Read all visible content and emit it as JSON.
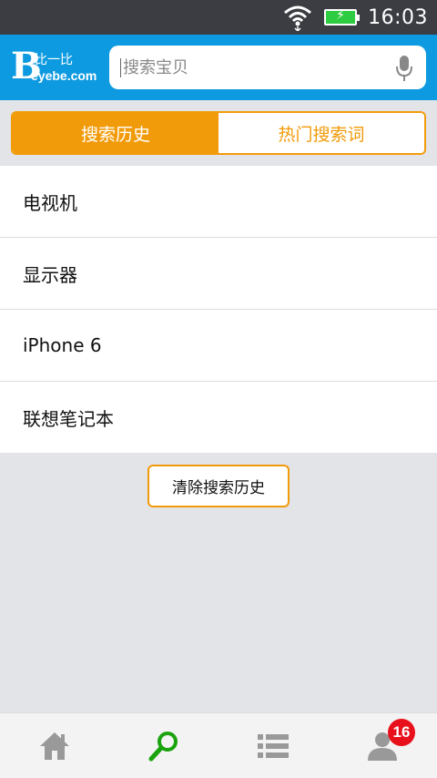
{
  "status_bar": {
    "time": "16:03",
    "icons": [
      "wifi-icon",
      "battery-charging-icon"
    ]
  },
  "header": {
    "logo": {
      "letter": "B",
      "cn_text": "比一比",
      "en_text": "eyebe.com"
    },
    "search": {
      "placeholder": "搜索宝贝",
      "value": ""
    },
    "mic_icon": "microphone-icon"
  },
  "tabs": [
    {
      "label": "搜索历史",
      "active": true
    },
    {
      "label": "热门搜索词",
      "active": false
    }
  ],
  "history": {
    "items": [
      "电视机",
      "显示器",
      "iPhone 6",
      "联想笔记本"
    ],
    "clear_label": "清除搜索历史"
  },
  "bottom_nav": {
    "items": [
      "home-icon",
      "search-icon",
      "list-icon",
      "user-icon"
    ],
    "active_index": 1,
    "badge_count": "16"
  },
  "colors": {
    "header_bg": "#0e9ae0",
    "accent_orange": "#f29b0a",
    "active_green": "#1aa30d",
    "badge_red": "#e8101a"
  }
}
